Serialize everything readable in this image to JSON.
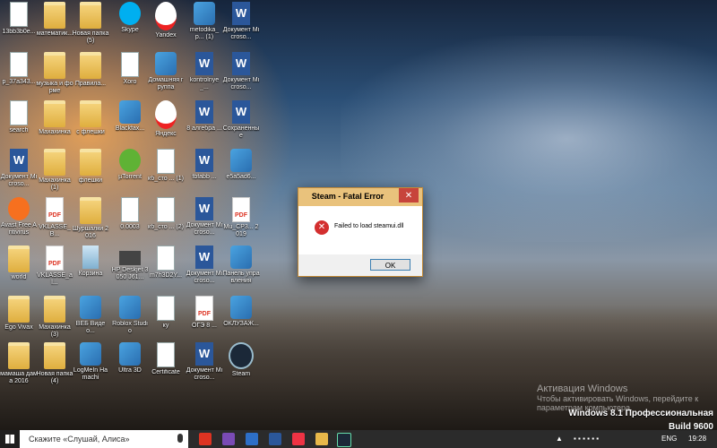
{
  "desktop": {
    "icons": [
      {
        "label": "13bb3b0e...",
        "kind": "doc"
      },
      {
        "label": "математик...",
        "kind": "folder"
      },
      {
        "label": "Новая папка (5)",
        "kind": "folder"
      },
      {
        "label": "Skype",
        "kind": "skype"
      },
      {
        "label": "Yandex",
        "kind": "yandex"
      },
      {
        "label": "metodika_p... (1)",
        "kind": "app"
      },
      {
        "label": "Документ Microso...",
        "kind": "word"
      },
      {
        "label": "p_37a343...",
        "kind": "doc"
      },
      {
        "label": "музыка и форме",
        "kind": "folder"
      },
      {
        "label": "Правила...",
        "kind": "folder"
      },
      {
        "label": "Xoro",
        "kind": "doc"
      },
      {
        "label": "Домашняя группа",
        "kind": "app"
      },
      {
        "label": "kontrolnye_...",
        "kind": "word"
      },
      {
        "label": "Документ Microso...",
        "kind": "word"
      },
      {
        "label": "search",
        "kind": "doc"
      },
      {
        "label": "Махахинка",
        "kind": "folder"
      },
      {
        "label": "с флешки",
        "kind": "folder"
      },
      {
        "label": "Blackfax...",
        "kind": "app"
      },
      {
        "label": "Яндекс",
        "kind": "yandex"
      },
      {
        "label": "8 алгебра ...",
        "kind": "word"
      },
      {
        "label": "Сохраненные",
        "kind": "word"
      },
      {
        "label": "Документ Microso...",
        "kind": "word"
      },
      {
        "label": "Махахинка (1)",
        "kind": "folder"
      },
      {
        "label": "флешки",
        "kind": "folder"
      },
      {
        "label": "µTorrent",
        "kind": "torrent"
      },
      {
        "label": "кб_сто ... (1)",
        "kind": "doc"
      },
      {
        "label": "fbfabb ...",
        "kind": "word"
      },
      {
        "label": "e5a5ad6...",
        "kind": "app"
      },
      {
        "label": "Avast Free Antivirus",
        "kind": "avast"
      },
      {
        "label": "VKLASSE_B...",
        "kind": "pdf"
      },
      {
        "label": "Шуршалки 2016",
        "kind": "folder"
      },
      {
        "label": "0.0003",
        "kind": "doc"
      },
      {
        "label": "кб_сто ... (2)",
        "kind": "doc"
      },
      {
        "label": "Документ Microso...",
        "kind": "word"
      },
      {
        "label": "Mu_CP3... 2019",
        "kind": "pdf"
      },
      {
        "label": "world",
        "kind": "folder"
      },
      {
        "label": "VKLASSE_al...",
        "kind": "pdf"
      },
      {
        "label": "Корзина",
        "kind": "recycle"
      },
      {
        "label": "HP Deskjet 3050 J61...",
        "kind": "printer"
      },
      {
        "label": "m7h3D2Y...",
        "kind": "doc"
      },
      {
        "label": "Документ Microso...",
        "kind": "word"
      },
      {
        "label": "Панель управления",
        "kind": "app"
      },
      {
        "label": "Ego Vivax",
        "kind": "folder"
      },
      {
        "label": "Махахинка (3)",
        "kind": "folder"
      },
      {
        "label": "ВЕБ Видео...",
        "kind": "app"
      },
      {
        "label": "Roblox Studio",
        "kind": "app"
      },
      {
        "label": "ку",
        "kind": "doc"
      },
      {
        "label": "ОГЭ 8 ...",
        "kind": "pdf"
      },
      {
        "label": "ОКЛУЗАЖ...",
        "kind": "app"
      },
      {
        "label": "мамаша дама 2016",
        "kind": "folder"
      },
      {
        "label": "Новая папка (4)",
        "kind": "folder"
      },
      {
        "label": "LogMeIn Hamachi",
        "kind": "app"
      },
      {
        "label": "Ultra 3D",
        "kind": "app"
      },
      {
        "label": "Certificate",
        "kind": "doc"
      },
      {
        "label": "Документ Microso...",
        "kind": "word"
      },
      {
        "label": "Steam",
        "kind": "steam"
      }
    ]
  },
  "dialog": {
    "title": "Steam - Fatal Error",
    "close": "✕",
    "message": "Failed to load steamui.dll",
    "ok": "OK"
  },
  "watermark": {
    "line1": "Активация Windows",
    "line2": "Чтобы активировать Windows, перейдите к",
    "line3": "параметрам компьютера."
  },
  "edition": {
    "line1": "Windows 8.1 Профессиональная",
    "line2": "Build 9600"
  },
  "taskbar": {
    "search_placeholder": "Скажите «Слушай, Алиса»",
    "lang": "ENG",
    "time": "19:28"
  },
  "colors": {
    "dialog_title": "#e9c27c",
    "close": "#c7443b",
    "taskbar": "#2b2b2b"
  }
}
